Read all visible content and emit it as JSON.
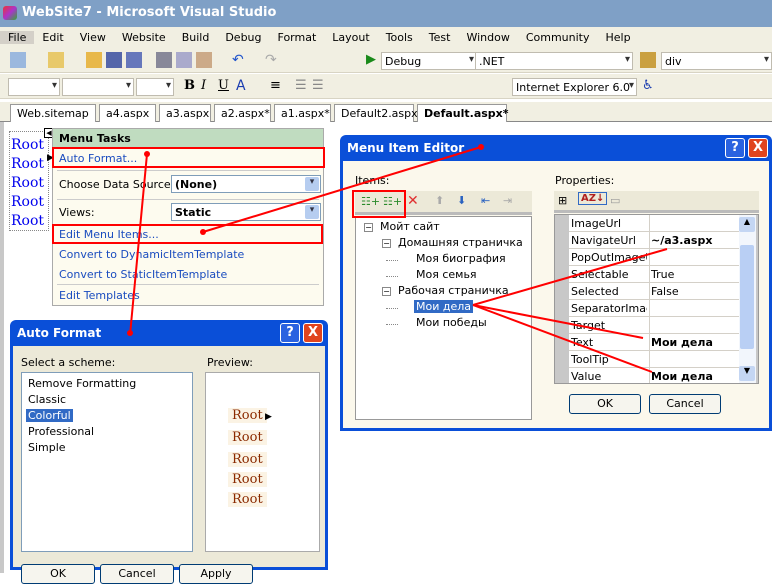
{
  "window": {
    "title": "WebSite7 - Microsoft Visual Studio"
  },
  "menu": [
    "File",
    "Edit",
    "View",
    "Website",
    "Build",
    "Debug",
    "Format",
    "Layout",
    "Tools",
    "Test",
    "Window",
    "Community",
    "Help"
  ],
  "toolbar": {
    "config": "Debug",
    "platform": ".NET",
    "find": "div",
    "browser": "Internet Explorer 6.0",
    "bold": "B",
    "italic": "I",
    "underline": "U"
  },
  "tabs": [
    "Web.sitemap",
    "a4.aspx",
    "a3.aspx",
    "a2.aspx*",
    "a1.aspx*",
    "Default2.aspx",
    "Default.aspx*"
  ],
  "design": {
    "roots": [
      "Root",
      "Root",
      "Root",
      "Root",
      "Root"
    ]
  },
  "menu_tasks": {
    "title": "Menu Tasks",
    "auto_format": "Auto Format...",
    "data_source_label": "Choose Data Source:",
    "data_source_value": "(None)",
    "views_label": "Views:",
    "views_value": "Static",
    "edit_items": "Edit Menu Items...",
    "convert_dynamic": "Convert to DynamicItemTemplate",
    "convert_static": "Convert to StaticItemTemplate",
    "edit_templates": "Edit Templates"
  },
  "auto_format": {
    "title": "Auto Format",
    "scheme_label": "Select a scheme:",
    "schemes": [
      "Remove Formatting",
      "Classic",
      "Colorful",
      "Professional",
      "Simple"
    ],
    "selected": "Colorful",
    "preview_label": "Preview:",
    "preview": [
      "Root",
      "Root",
      "Root",
      "Root",
      "Root"
    ],
    "ok": "OK",
    "cancel": "Cancel",
    "apply": "Apply",
    "help": "?",
    "close": "X"
  },
  "item_editor": {
    "title": "Menu Item Editor",
    "items_label": "Items:",
    "properties_label": "Properties:",
    "tree": [
      {
        "text": "Мойт сайт",
        "level": 0
      },
      {
        "text": "Домашняя страничка",
        "level": 1
      },
      {
        "text": "Моя биография",
        "level": 2
      },
      {
        "text": "Моя семья",
        "level": 2
      },
      {
        "text": "Рабочая страничка",
        "level": 1
      },
      {
        "text": "Мои дела",
        "level": 2,
        "selected": true
      },
      {
        "text": "Мои победы",
        "level": 2
      }
    ],
    "properties": [
      {
        "name": "ImageUrl",
        "value": ""
      },
      {
        "name": "NavigateUrl",
        "value": "~/a3.aspx",
        "bold": true
      },
      {
        "name": "PopOutImageUrl",
        "value": ""
      },
      {
        "name": "Selectable",
        "value": "True"
      },
      {
        "name": "Selected",
        "value": "False"
      },
      {
        "name": "SeparatorImageUrl",
        "value": ""
      },
      {
        "name": "Target",
        "value": ""
      },
      {
        "name": "Text",
        "value": "Мои дела",
        "bold": true
      },
      {
        "name": "ToolTip",
        "value": ""
      },
      {
        "name": "Value",
        "value": "Мои дела",
        "bold": true
      }
    ],
    "ok": "OK",
    "cancel": "Cancel",
    "help": "?",
    "close": "X"
  },
  "colors": {
    "titlebar": "#7fa0c6",
    "dialog_caption": "#0a4fd8",
    "annotation": "#ff0000",
    "selection": "#316ac5"
  }
}
